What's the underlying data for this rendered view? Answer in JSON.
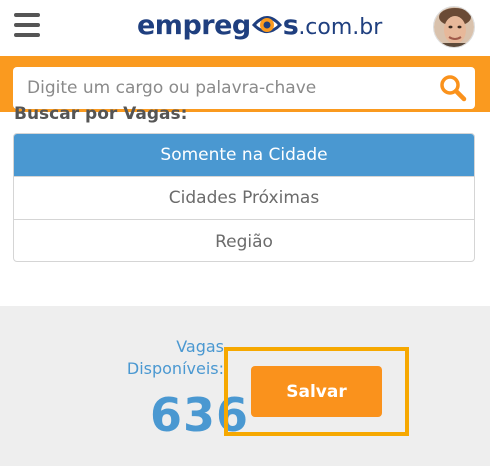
{
  "header": {
    "logo_main": "empreg",
    "logo_tail": "s",
    "logo_domain": ".com.br",
    "menu_icon": "hamburger-menu-icon",
    "avatar_icon": "user-avatar"
  },
  "search": {
    "placeholder": "Digite um cargo ou palavra-chave",
    "value": "",
    "icon": "search-icon"
  },
  "filter": {
    "section_label": "Buscar por Vagas:",
    "options": [
      {
        "label": "Somente na Cidade",
        "selected": true
      },
      {
        "label": "Cidades Próximas",
        "selected": false
      },
      {
        "label": "Região",
        "selected": false
      }
    ]
  },
  "results": {
    "label_line1": "Vagas",
    "label_line2": "Disponíveis:",
    "count": "636"
  },
  "actions": {
    "save_label": "Salvar"
  },
  "colors": {
    "accent_orange": "#fa9a1f",
    "selected_blue": "#4a98d1",
    "brand_navy": "#1f3f7f",
    "highlight": "#f6a800"
  }
}
